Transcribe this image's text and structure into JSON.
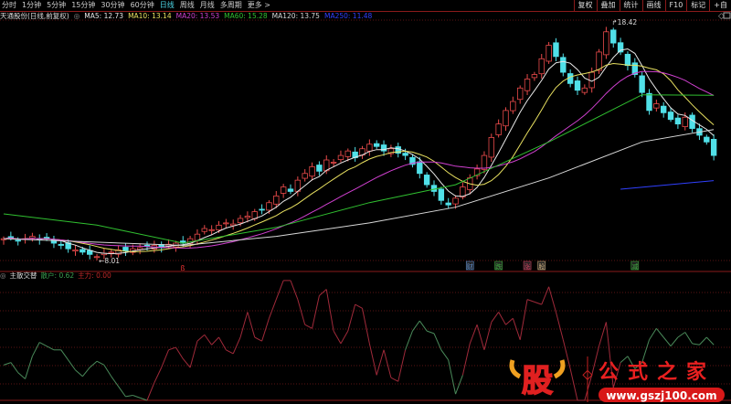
{
  "tabs": [
    "分时",
    "1分钟",
    "5分钟",
    "15分钟",
    "30分钟",
    "60分钟",
    "日线",
    "周线",
    "月线",
    "多周期",
    "更多 >"
  ],
  "active_tab": "日线",
  "right_buttons": [
    "复权",
    "叠加",
    "统计",
    "画线",
    "F10",
    "标记",
    "+自"
  ],
  "legend": {
    "title": "天通股份(日线,前复权)",
    "ma": [
      {
        "label": "MA5: 12.73",
        "color": "#e8e8e8"
      },
      {
        "label": "MA10: 13.14",
        "color": "#e8e060"
      },
      {
        "label": "MA20: 13.53",
        "color": "#d040d0"
      },
      {
        "label": "MA60: 15.28",
        "color": "#30c030"
      },
      {
        "label": "MA120: 13.75",
        "color": "#d8d8d8"
      },
      {
        "label": "MA250: 11.48",
        "color": "#3040ff"
      }
    ]
  },
  "indicator_legend": {
    "name": "主散交替",
    "sanhu": {
      "label": "散户: 0.62",
      "color": "#3aa050"
    },
    "zhuli": {
      "label": "主力: 0.00",
      "color": "#c02828"
    }
  },
  "markers": [
    {
      "text": "财",
      "color": "#6090d0",
      "index": 65
    },
    {
      "text": "跌",
      "color": "#40b040",
      "index": 69
    },
    {
      "text": "涨",
      "color": "#d04060",
      "index": 73
    },
    {
      "text": "股",
      "color": "#d0b080",
      "index": 75
    },
    {
      "text": "减",
      "color": "#40b040",
      "index": 88
    }
  ],
  "watermark": {
    "logo": "股",
    "name": "公式之家",
    "url": "www.gszj100.com"
  },
  "chart_data": {
    "type": "candlestick",
    "annotations": [
      {
        "text": "18.42",
        "type": "high"
      },
      {
        "text": "8.01",
        "type": "low"
      }
    ],
    "price_range": [
      8.01,
      18.42
    ],
    "closes": [
      8.9,
      8.95,
      8.8,
      8.9,
      9.0,
      8.85,
      8.9,
      8.7,
      8.6,
      8.45,
      8.4,
      8.3,
      8.2,
      8.1,
      8.25,
      8.3,
      8.4,
      8.35,
      8.45,
      8.5,
      8.55,
      8.6,
      8.5,
      8.65,
      8.7,
      8.7,
      8.9,
      9.1,
      9.35,
      9.3,
      9.5,
      9.6,
      9.55,
      9.8,
      9.9,
      10.1,
      10.2,
      10.5,
      10.8,
      11.2,
      11.0,
      11.5,
      11.8,
      12.1,
      11.9,
      12.4,
      12.3,
      12.6,
      12.8,
      12.5,
      12.9,
      13.1,
      13.0,
      12.8,
      12.9,
      12.7,
      12.6,
      12.2,
      11.8,
      11.3,
      11.0,
      10.6,
      10.4,
      10.7,
      11.2,
      11.6,
      12.0,
      12.6,
      13.4,
      14.0,
      14.6,
      15.0,
      15.6,
      16.0,
      16.2,
      16.9,
      17.5,
      17.0,
      16.3,
      15.8,
      15.5,
      15.6,
      16.3,
      17.2,
      18.1,
      17.6,
      17.2,
      16.6,
      16.2,
      15.4,
      14.6,
      14.9,
      14.5,
      14.2,
      14.0,
      14.3,
      13.8,
      13.5,
      13.2,
      12.6
    ],
    "ma_long": {
      "MA60": [
        [
          0,
          10.0
        ],
        [
          13,
          9.5
        ],
        [
          25,
          8.7
        ],
        [
          38,
          9.4
        ],
        [
          51,
          10.5
        ],
        [
          63,
          11.3
        ],
        [
          76,
          13.2
        ],
        [
          89,
          15.3
        ],
        [
          99,
          15.28
        ]
      ],
      "MA120": [
        [
          0,
          8.9
        ],
        [
          25,
          8.6
        ],
        [
          38,
          9.0
        ],
        [
          51,
          9.6
        ],
        [
          63,
          10.3
        ],
        [
          76,
          11.6
        ],
        [
          89,
          13.2
        ],
        [
          99,
          13.75
        ]
      ],
      "MA250": [
        [
          86,
          11.1
        ],
        [
          99,
          11.48
        ]
      ]
    },
    "indicator": {
      "values": [
        0.28,
        0.3,
        0.22,
        0.17,
        0.35,
        0.46,
        0.43,
        0.4,
        0.4,
        0.32,
        0.24,
        0.19,
        0.26,
        0.31,
        0.28,
        0.19,
        0.11,
        0.03,
        0.04,
        0.02,
        0,
        0.14,
        0.26,
        0.4,
        0.42,
        0.33,
        0.26,
        0.47,
        0.52,
        0.44,
        0.5,
        0.4,
        0.37,
        0.5,
        0.7,
        0.5,
        0.47,
        0.65,
        0.8,
        0.95,
        0.95,
        0.8,
        0.6,
        0.57,
        0.83,
        0.88,
        0.55,
        0.45,
        0.55,
        0.76,
        0.73,
        0.45,
        0.2,
        0.4,
        0.18,
        0.15,
        0.4,
        0.55,
        0.63,
        0.55,
        0.53,
        0.4,
        0.32,
        0.05,
        0.2,
        0.45,
        0.6,
        0.4,
        0.62,
        0.7,
        0.6,
        0.65,
        0.48,
        0.8,
        0.78,
        0.76,
        0.9,
        0.7,
        0.48,
        0.25,
        0,
        0,
        0.2,
        0.43,
        0.62,
        0.1,
        0.3,
        0.35,
        0.25,
        0.3,
        0.48,
        0.57,
        0.5,
        0.43,
        0.5,
        0.54,
        0.45,
        0.44,
        0.5,
        0.44
      ],
      "side": "ssssssssssssssssssssszzzzzzzzzzzzzzzzzzzzzzzzzzzzzzzzzzzsssssssszzzzzzzzzzzzzzzzzzzzzzsssssssssssssss"
    }
  }
}
